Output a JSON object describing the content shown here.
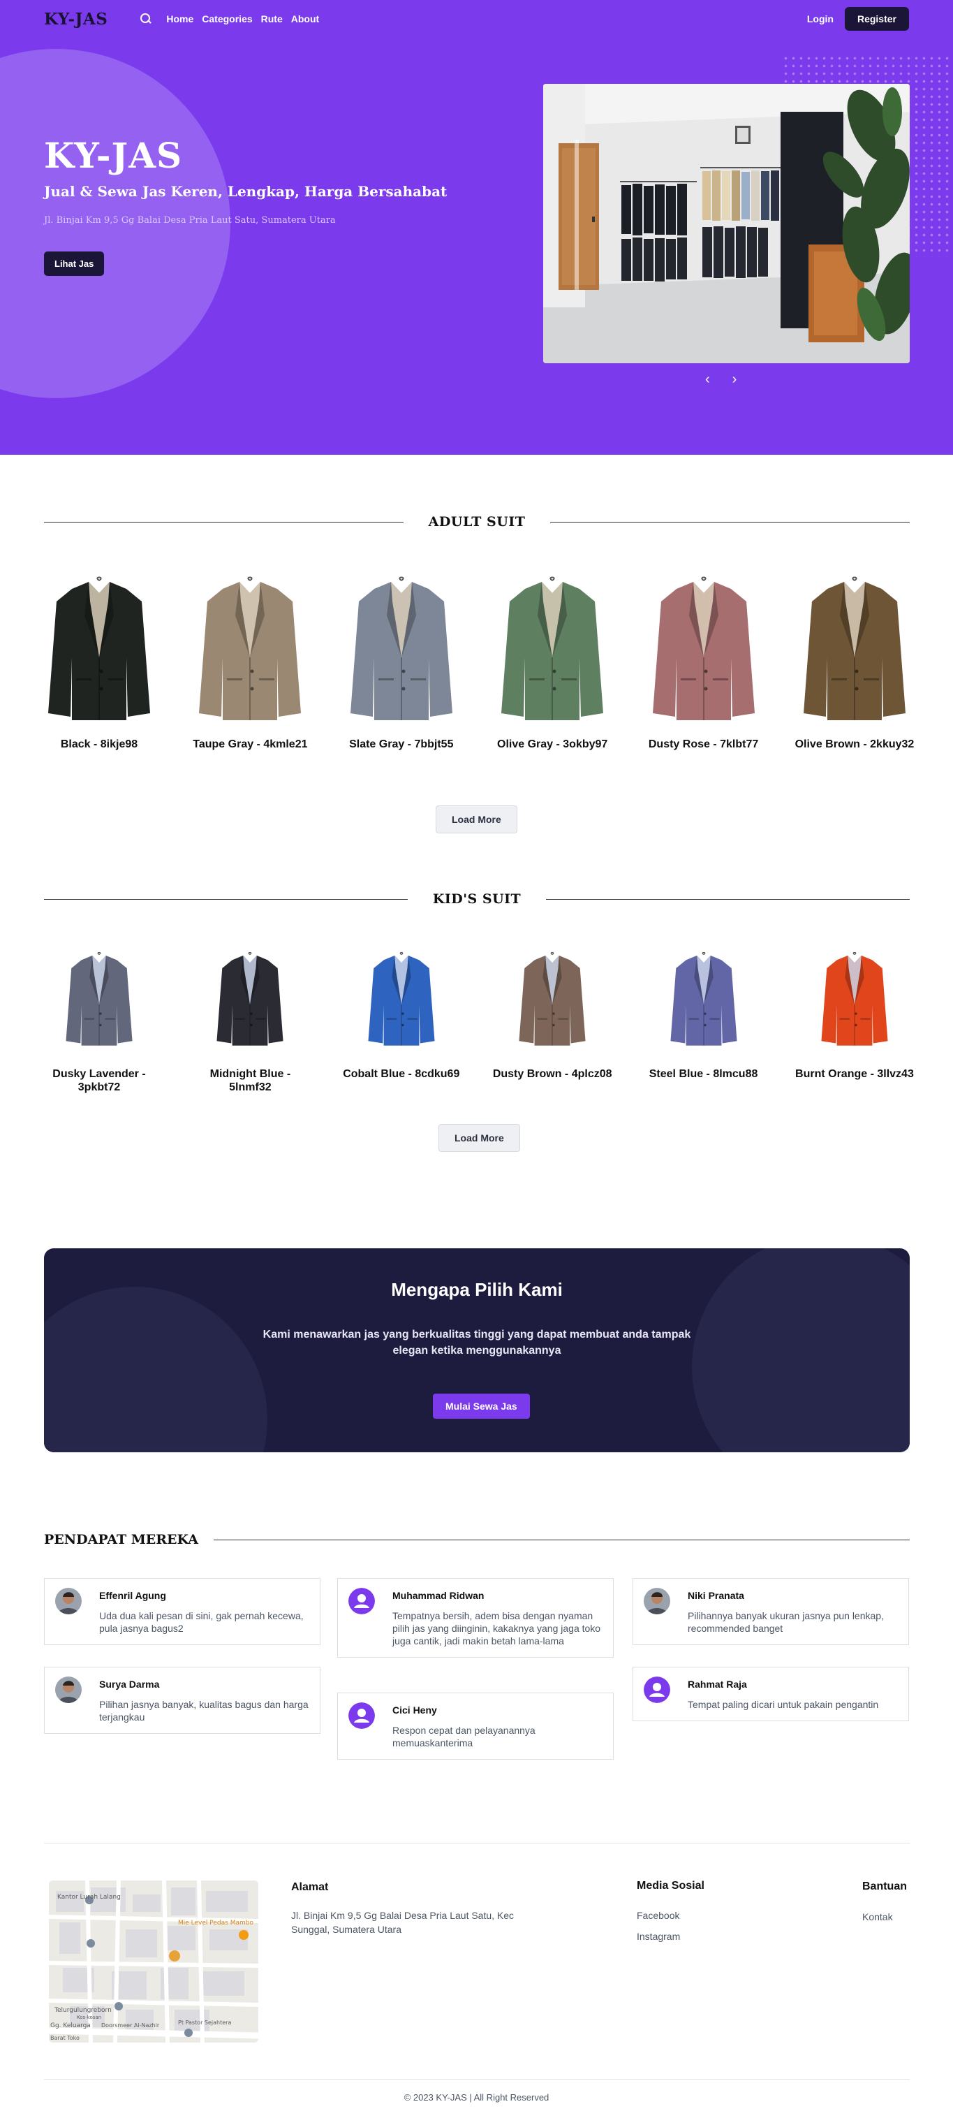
{
  "nav": {
    "brand": "KY-JAS",
    "links": [
      "Home",
      "Categories",
      "Rute",
      "About"
    ],
    "login": "Login",
    "register": "Register"
  },
  "hero": {
    "title": "KY-JAS",
    "subtitle": "Jual & Sewa Jas Keren, Lengkap, Harga Bersahabat",
    "address": "Jl. Binjai Km 9,5 Gg Balai Desa Pria Laut Satu, Sumatera Utara",
    "cta": "Lihat Jas",
    "prev_icon": "‹",
    "next_icon": "›"
  },
  "adult": {
    "title": "ADULT SUIT",
    "items": [
      {
        "name": "Black - 8ikje98",
        "color": "#1f2420"
      },
      {
        "name": "Taupe Gray - 4kmle21",
        "color": "#9a8872"
      },
      {
        "name": "Slate Gray - 7bbjt55",
        "color": "#7e8797"
      },
      {
        "name": "Olive Gray - 3okby97",
        "color": "#5f7f61"
      },
      {
        "name": "Dusty Rose - 7klbt77",
        "color": "#a66e6f"
      },
      {
        "name": "Olive Brown - 2kkuy32",
        "color": "#6d5536"
      }
    ],
    "load_more": "Load More"
  },
  "kids": {
    "title": "KID'S SUIT",
    "items": [
      {
        "name": "Dusky Lavender - 3pkbt72",
        "color": "#63677c"
      },
      {
        "name": "Midnight Blue - 5lnmf32",
        "color": "#2a2b33"
      },
      {
        "name": "Cobalt Blue - 8cdku69",
        "color": "#2e63bf"
      },
      {
        "name": "Dusty Brown - 4plcz08",
        "color": "#7d6659"
      },
      {
        "name": "Steel Blue - 8lmcu88",
        "color": "#6266a6"
      },
      {
        "name": "Burnt Orange - 3llvz43",
        "color": "#e0451c"
      }
    ],
    "load_more": "Load More"
  },
  "why": {
    "title": "Mengapa Pilih Kami",
    "text": "Kami menawarkan jas yang berkualitas tinggi yang dapat membuat anda tampak elegan ketika menggunakannya",
    "cta": "Mulai Sewa Jas"
  },
  "testimonials": {
    "title": "PENDAPAT MEREKA",
    "items": [
      {
        "name": "Effenril Agung",
        "text": "Uda dua kali pesan di sini, gak pernah kecewa, pula jasnya bagus2",
        "avatar": "photo"
      },
      {
        "name": "Muhammad Ridwan",
        "text": "Tempatnya bersih, adem bisa dengan nyaman pilih jas yang diinginin, kakaknya yang jaga toko juga cantik, jadi makin betah lama-lama",
        "avatar": "user-icon"
      },
      {
        "name": "Niki Pranata",
        "text": "Pilihannya banyak ukuran jasnya pun lenkap, recommended banget",
        "avatar": "photo"
      },
      {
        "name": "Surya Darma",
        "text": "Pilihan jasnya banyak, kualitas bagus dan harga terjangkau",
        "avatar": "photo"
      },
      {
        "name": "Cici Heny",
        "text": "Respon cepat dan pelayanannya memuaskanterima",
        "avatar": "user-icon"
      },
      {
        "name": "Rahmat Raja",
        "text": "Tempat paling dicari untuk pakain pengantin",
        "avatar": "user-icon"
      }
    ]
  },
  "footer": {
    "map_labels": [
      "Kantor Lurah Lalang",
      "Mie Level Pedas Mambo",
      "Telurgulungreborn",
      "Kos-kosan",
      "Gg. Keluarga",
      "Doorsmeer Al-Nazhir",
      "Pt Pastor Sejahtera",
      "Barat Toko"
    ],
    "address_title": "Alamat",
    "address": "Jl. Binjai Km 9,5 Gg Balai Desa Pria Laut Satu, Kec Sunggal, Sumatera Utara",
    "social_title": "Media Sosial",
    "social_links": [
      "Facebook",
      "Instagram"
    ],
    "help_title": "Bantuan",
    "help_links": [
      "Kontak"
    ],
    "copyright": "© 2023 KY-JAS | All Right Reserved"
  },
  "colors": {
    "primary": "#7c3aed",
    "dark": "#1b1638",
    "why_bg": "#1d1c3f"
  }
}
